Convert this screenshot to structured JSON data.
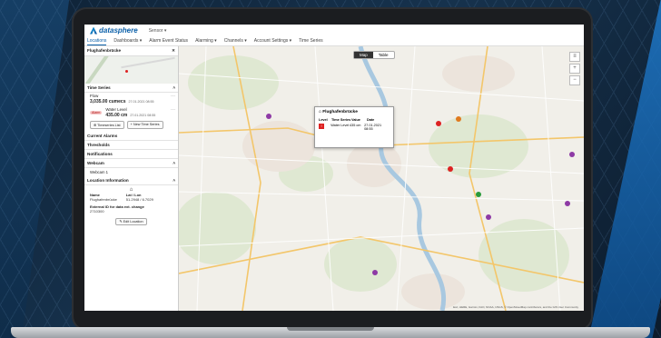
{
  "app": {
    "brand": "datasphere",
    "org": "Sensor"
  },
  "nav": [
    "Locations",
    "Dashboards ▾",
    "Alarm Event Status",
    "Alarming ▾",
    "Channels ▾",
    "Account Settings ▾",
    "Time Series"
  ],
  "sidebar": {
    "title": "Flughafenbrücke",
    "time_series_label": "Time Series",
    "series": [
      {
        "name": "Flow",
        "value": "3,035.00 cumecs",
        "timestamp": "27.01.2021 08:55"
      },
      {
        "name": "Water Level",
        "value": "435.00 cm",
        "timestamp": "27.01.2021 08:55",
        "badge": "Alarm"
      }
    ],
    "buttons": {
      "timeseries_list": "Timeseries List",
      "new_time_series": "New Time Series"
    },
    "sections": {
      "current_alarms": "Current Alarms",
      "thresholds": "Thresholds",
      "notifications": "Notifications",
      "webcam": "Webcam",
      "location_info": "Location Information"
    },
    "webcam_item": "Webcam 1",
    "location": {
      "name_label": "Name",
      "name_value": "Flughafenbrücke",
      "latlon_label": "Lat / Lon",
      "latlon_value": "51.2948 / 6.7029",
      "ext_label": "External ID for data ext. change",
      "ext_value": "2710300"
    },
    "edit_location": "Edit Location"
  },
  "map": {
    "toggle": {
      "map": "Map",
      "table": "Table"
    },
    "popup": {
      "title": "Flughafenbrücke",
      "headers": [
        "Level",
        "Time Series",
        "Value",
        "Date"
      ],
      "row": {
        "series": "Water Level",
        "value": "435 cm",
        "date": "27.01.2021 08:55"
      }
    },
    "attribution": "Esri, HERE, Garmin, FAO, NOAA, USGS, © OpenStreetMap contributors, and the GIS User Community"
  },
  "colors": {
    "accent": "#0a5fa8",
    "alarm": "#d22222"
  }
}
